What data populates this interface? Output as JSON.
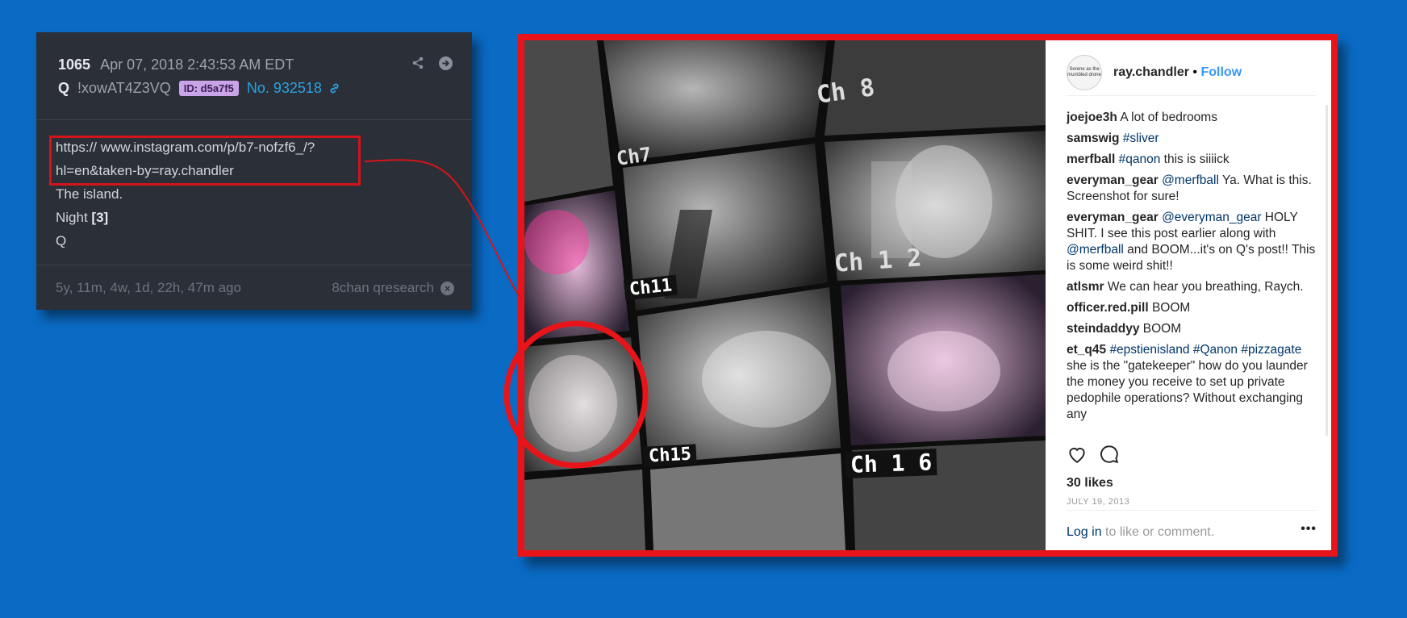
{
  "post": {
    "number": "1065",
    "date": "Apr 07, 2018 2:43:53 AM EDT",
    "author": "Q",
    "tripcode": "!xowAT4Z3VQ",
    "id_badge": "ID: d5a7f5",
    "post_no": "No. 932518",
    "body": {
      "url_line1": "https:// www.instagram.com/p/b7-nofzf6_/?",
      "url_line2": "hl=en&taken-by=ray.chandler",
      "line3": "The island.",
      "line4_prefix": "Night ",
      "line4_bold": "[3]",
      "line5": "Q"
    },
    "footer": {
      "age": "5y, 11m, 4w, 1d, 22h, 47m ago",
      "source": "8chan qresearch"
    },
    "icons": [
      "share-icon",
      "arrow-circle-right-icon",
      "link-icon",
      "close-circle-icon"
    ]
  },
  "instagram": {
    "username": "ray.chandler",
    "separator": "•",
    "follow": "Follow",
    "comments": [
      {
        "user": "joejoe3h",
        "parts": [
          {
            "t": "A lot of bedrooms"
          }
        ]
      },
      {
        "user": "samswig",
        "parts": [
          {
            "t": "#sliver",
            "tag": true
          }
        ]
      },
      {
        "user": "merfball",
        "parts": [
          {
            "t": "#qanon",
            "tag": true
          },
          {
            "t": " this is siiiick"
          }
        ]
      },
      {
        "user": "everyman_gear",
        "parts": [
          {
            "t": "@merfball",
            "tag": true
          },
          {
            "t": " Ya. What is this. Screenshot for sure!"
          }
        ]
      },
      {
        "user": "everyman_gear",
        "parts": [
          {
            "t": "@everyman_gear",
            "tag": true
          },
          {
            "t": " HOLY SHIT. I see this post earlier along with "
          },
          {
            "t": "@merfball",
            "tag": true
          },
          {
            "t": " and BOOM...it's on Q's post!! This is some weird shit!!"
          }
        ]
      },
      {
        "user": "atlsmr",
        "parts": [
          {
            "t": "We can hear you breathing, Raych."
          }
        ]
      },
      {
        "user": "officer.red.pill",
        "parts": [
          {
            "t": "BOOM"
          }
        ]
      },
      {
        "user": "steindaddyy",
        "parts": [
          {
            "t": "BOOM"
          }
        ]
      },
      {
        "user": "et_q45",
        "parts": [
          {
            "t": "#epstienisland",
            "tag": true
          },
          {
            "t": " "
          },
          {
            "t": "#Qanon",
            "tag": true
          },
          {
            "t": " "
          },
          {
            "t": "#pizzagate",
            "tag": true
          },
          {
            "t": " she is the \"gatekeeper\" how do you launder the money you receive to set up private pedophile operations? Without exchanging any"
          }
        ]
      }
    ],
    "likes": "30 likes",
    "date": "JULY 19, 2013",
    "login_link": "Log in",
    "login_rest": " to like or comment.",
    "more": "•••",
    "avatar_text": "Serene as the mumbled drone",
    "photo_channels": [
      "Ch 8",
      "Ch7",
      "Ch 1 2",
      "Ch11",
      "Ch15",
      "Ch 1 6"
    ],
    "icons": [
      "heart-icon",
      "comment-icon",
      "more-icon"
    ]
  },
  "colors": {
    "background": "#0a6ac4",
    "highlight": "#e8141a",
    "post_bg": "#2b2f37",
    "id_badge": "#c9a4e8",
    "link": "#2aa2e0",
    "ig_blue": "#3897f0",
    "ig_tag": "#003569"
  }
}
